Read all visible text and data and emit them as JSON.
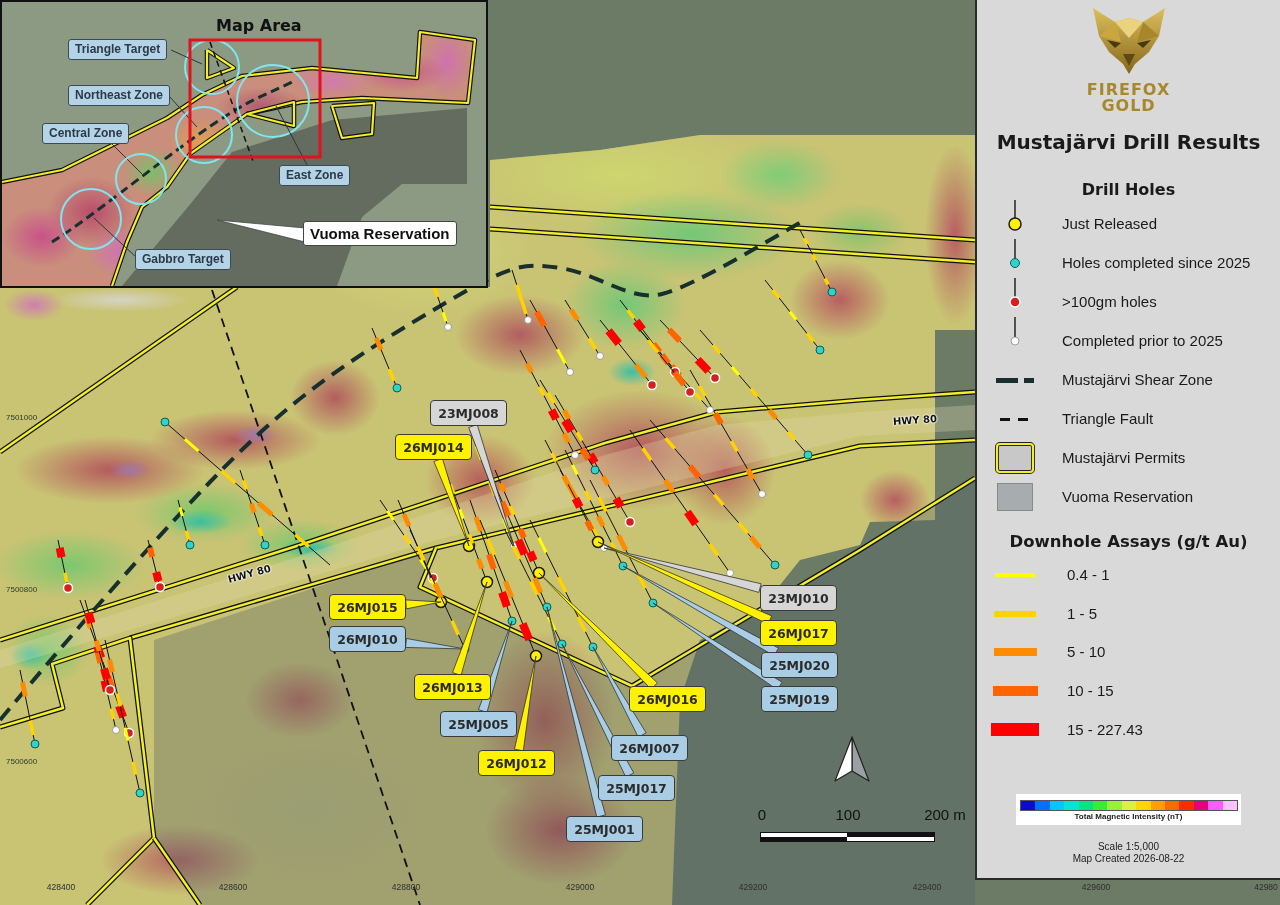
{
  "inset": {
    "title": "Map Area",
    "zones": [
      {
        "label": "Triangle Target"
      },
      {
        "label": "Northeast Zone"
      },
      {
        "label": "Central Zone"
      },
      {
        "label": "East Zone"
      },
      {
        "label": "Gabbro Target"
      }
    ],
    "reservation_label": "Vuoma Reservation"
  },
  "map": {
    "northings": [
      "7501000",
      "7500800",
      "7500600"
    ],
    "road_labels": [
      "HWY 80",
      "HWY 80"
    ],
    "hole_labels": [
      {
        "text": "23MJ008",
        "kind": "prior"
      },
      {
        "text": "26MJ014",
        "kind": "just_released"
      },
      {
        "text": "26MJ015",
        "kind": "just_released"
      },
      {
        "text": "26MJ010",
        "kind": "recent"
      },
      {
        "text": "26MJ013",
        "kind": "just_released"
      },
      {
        "text": "25MJ005",
        "kind": "recent"
      },
      {
        "text": "26MJ012",
        "kind": "just_released"
      },
      {
        "text": "26MJ016",
        "kind": "just_released"
      },
      {
        "text": "26MJ007",
        "kind": "recent"
      },
      {
        "text": "25MJ017",
        "kind": "recent"
      },
      {
        "text": "25MJ001",
        "kind": "recent"
      },
      {
        "text": "23MJ010",
        "kind": "prior"
      },
      {
        "text": "26MJ017",
        "kind": "just_released"
      },
      {
        "text": "25MJ020",
        "kind": "recent"
      },
      {
        "text": "25MJ019",
        "kind": "recent"
      }
    ],
    "scale_bar": [
      "0",
      "100",
      "200 m"
    ],
    "eastings": [
      "428400",
      "428600",
      "428800",
      "429000",
      "429200",
      "429400",
      "429600",
      "42980"
    ]
  },
  "legend": {
    "logo": [
      "FIREFOX",
      "GOLD"
    ],
    "title": "Mustajärvi Drill Results",
    "drill_heading": "Drill Holes",
    "symbols": [
      {
        "kind": "just_released",
        "label": "Just Released"
      },
      {
        "kind": "recent",
        "label": "Holes completed since 2025"
      },
      {
        "kind": "high_grade",
        "label": ">100gm holes"
      },
      {
        "kind": "prior",
        "label": "Completed prior to 2025"
      },
      {
        "kind": "shear_zone",
        "label": "Mustajärvi Shear Zone"
      },
      {
        "kind": "fault",
        "label": "Triangle Fault"
      },
      {
        "kind": "permit",
        "label": "Mustajärvi Permits"
      },
      {
        "kind": "reservation",
        "label": "Vuoma Reservation"
      }
    ],
    "assay_heading": "Downhole Assays (g/t Au)",
    "assays": [
      {
        "label": "0.4 - 1",
        "color": "#ffff00"
      },
      {
        "label": "1 - 5",
        "color": "#ffd200"
      },
      {
        "label": "5 - 10",
        "color": "#ff8c00"
      },
      {
        "label": "10 - 15",
        "color": "#ff6400"
      },
      {
        "label": "15 - 227.43",
        "color": "#ff0000"
      }
    ],
    "colorbar_caption": "Total Magnetic Intensity (nT)",
    "scale": "Scale 1:5,000",
    "created": "Map Created 2026-08-22"
  }
}
